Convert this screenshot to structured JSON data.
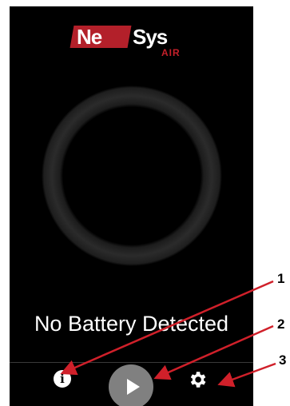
{
  "brand": {
    "logo_text_1": "Ne",
    "logo_text_2": "Sys",
    "logo_sub": "AIR",
    "brand_red": "#b3202a"
  },
  "status": {
    "text": "No Battery Detected"
  },
  "bottom_bar": {
    "info_icon": "info-icon",
    "play_icon": "play-icon",
    "settings_icon": "gear-icon",
    "info_glyph": "i"
  },
  "callouts": {
    "one": "1",
    "two": "2",
    "three": "3",
    "arrow_color": "#d0202a"
  }
}
